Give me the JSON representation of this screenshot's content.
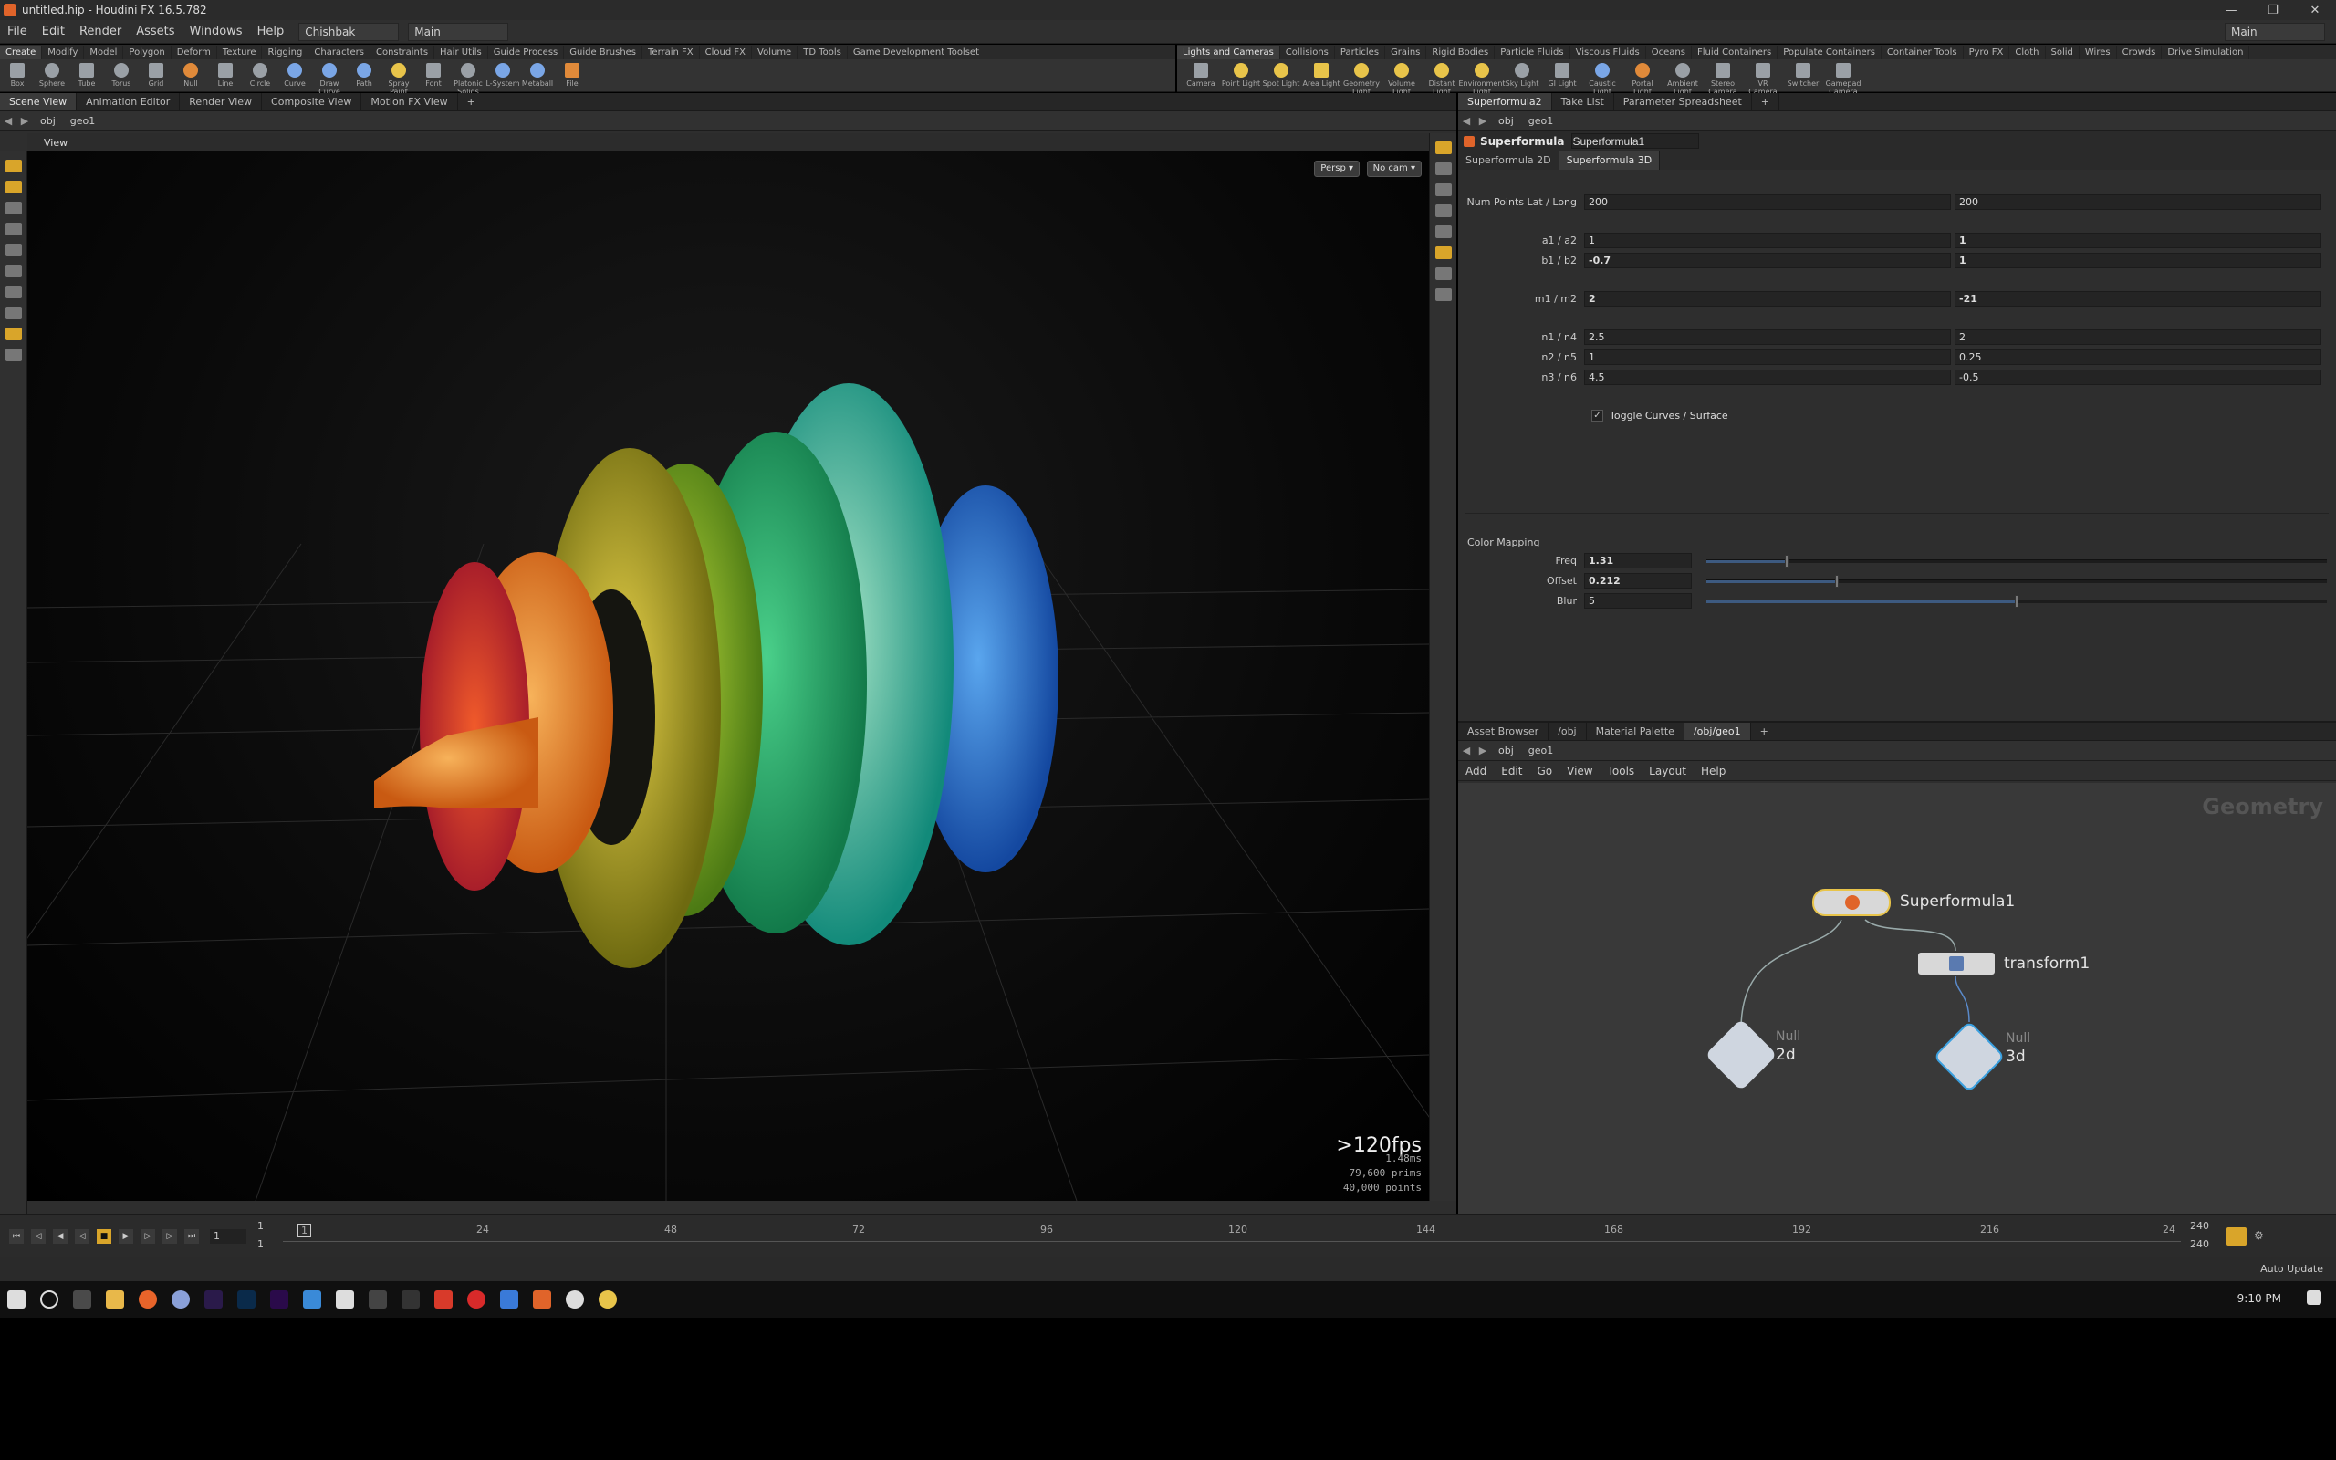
{
  "titlebar": {
    "title": "untitled.hip - Houdini FX 16.5.782",
    "minimize": "—",
    "maximize": "❐",
    "close": "✕"
  },
  "menubar": {
    "items": [
      "File",
      "Edit",
      "Render",
      "Assets",
      "Windows",
      "Help"
    ],
    "desktop": "Chishbak",
    "pane": "Main",
    "right_pane": "Main"
  },
  "shelf_left": {
    "tabs": [
      "Create",
      "Modify",
      "Model",
      "Polygon",
      "Deform",
      "Texture",
      "Rigging",
      "Characters",
      "Constraints",
      "Hair Utils",
      "Guide Process",
      "Guide Brushes",
      "Terrain FX",
      "Cloud FX",
      "Volume",
      "TD Tools",
      "Game Development Toolset"
    ],
    "tools": [
      "Box",
      "Sphere",
      "Tube",
      "Torus",
      "Grid",
      "Null",
      "Line",
      "Circle",
      "Curve",
      "Draw Curve",
      "Path",
      "Spray Paint",
      "Font",
      "Platonic Solids",
      "L-System",
      "Metaball",
      "File"
    ]
  },
  "shelf_right": {
    "tabs": [
      "Lights and Cameras",
      "Collisions",
      "Particles",
      "Grains",
      "Rigid Bodies",
      "Particle Fluids",
      "Viscous Fluids",
      "Oceans",
      "Fluid Containers",
      "Populate Containers",
      "Container Tools",
      "Pyro FX",
      "Cloth",
      "Solid",
      "Wires",
      "Crowds",
      "Drive Simulation"
    ],
    "tools": [
      "Camera",
      "Point Light",
      "Spot Light",
      "Area Light",
      "Geometry Light",
      "Volume Light",
      "Distant Light",
      "Environment Light",
      "Sky Light",
      "GI Light",
      "Caustic Light",
      "Portal Light",
      "Ambient Light",
      "Stereo Camera",
      "VR Camera",
      "Switcher",
      "Gamepad Camera"
    ]
  },
  "left_pane": {
    "tabs": [
      "Scene View",
      "Animation Editor",
      "Render View",
      "Composite View",
      "Motion FX View"
    ],
    "path": [
      "obj",
      "geo1"
    ],
    "view_label": "View",
    "persp": "Persp ▾",
    "cam": "No cam ▾",
    "fps": ">120fps",
    "time": "1.48ms",
    "prims": "79,600  prims",
    "points": "40,000 points"
  },
  "param_pane": {
    "tabs": [
      "Superformula2",
      "Take List",
      "Parameter Spreadsheet"
    ],
    "path": [
      "obj",
      "geo1"
    ],
    "node_type": "Superformula",
    "node_name": "Superformula1",
    "subtabs": [
      "Superformula 2D",
      "Superformula 3D"
    ],
    "rows": [
      {
        "label": "Num Points Lat / Long",
        "v1": "200",
        "v2": "200"
      },
      {
        "label": "a1 / a2",
        "v1": "1",
        "v2": "1"
      },
      {
        "label": "b1 / b2",
        "v1": "-0.7",
        "v2": "1"
      },
      {
        "label": "m1 / m2",
        "v1": "2",
        "v2": "-21"
      },
      {
        "label": "n1 / n4",
        "v1": "2.5",
        "v2": "2"
      },
      {
        "label": "n2 / n5",
        "v1": "1",
        "v2": "0.25"
      },
      {
        "label": "n3 / n6",
        "v1": "4.5",
        "v2": "-0.5"
      }
    ],
    "toggle_label": "Toggle Curves / Surface",
    "color_mapping": "Color Mapping",
    "sliders": [
      {
        "label": "Freq",
        "value": "1.31",
        "level": 0.13
      },
      {
        "label": "Offset",
        "value": "0.212",
        "level": 0.21
      },
      {
        "label": "Blur",
        "value": "5",
        "level": 0.5
      }
    ]
  },
  "network_pane": {
    "tabs": [
      "Asset Browser",
      "/obj",
      "Material Palette",
      "/obj/geo1"
    ],
    "path": [
      "obj",
      "geo1"
    ],
    "menu": [
      "Add",
      "Edit",
      "Go",
      "View",
      "Tools",
      "Layout",
      "Help"
    ],
    "context": "Geometry",
    "nodes": {
      "superformula": "Superformula1",
      "transform": "transform1",
      "null2d_type": "Null",
      "null2d": "2d",
      "null3d_type": "Null",
      "null3d": "3d"
    }
  },
  "timeline": {
    "frame": "1",
    "start": "1",
    "start2": "1",
    "end": "240",
    "end2": "240",
    "ticks": [
      "1",
      "24",
      "48",
      "72",
      "96",
      "120",
      "144",
      "168",
      "192",
      "216",
      "24"
    ],
    "auto_update": "Auto Update"
  },
  "taskbar": {
    "time": "9:10 PM"
  }
}
